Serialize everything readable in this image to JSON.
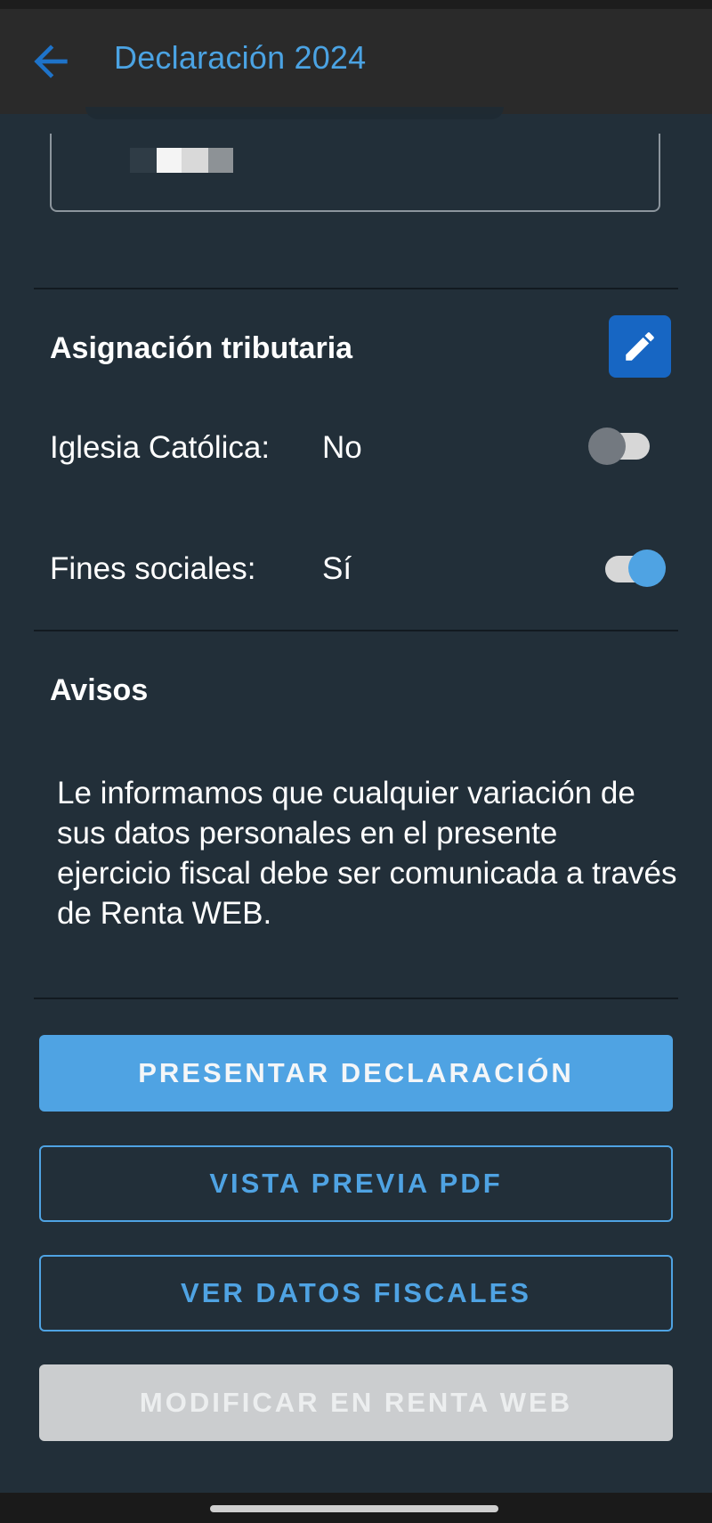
{
  "app_bar": {
    "title": "Declaración 2024",
    "back_icon": "arrow-left-icon"
  },
  "assignment": {
    "title": "Asignación tributaria",
    "edit_icon": "pencil-icon",
    "rows": [
      {
        "label": "Iglesia Católica:",
        "value": "No",
        "enabled": false
      },
      {
        "label": "Fines sociales:",
        "value": "Sí",
        "enabled": true
      }
    ]
  },
  "notices": {
    "title": "Avisos",
    "text": "Le informamos que cualquier variación de sus datos personales en el presente ejercicio fiscal debe ser comunicada a través de Renta WEB."
  },
  "actions": {
    "present": "PRESENTAR DECLARACIÓN",
    "preview_pdf": "VISTA PREVIA PDF",
    "fiscal_data": "VER DATOS FISCALES",
    "modify_web": "MODIFICAR EN RENTA WEB"
  },
  "colors": {
    "accent": "#4fa3e3",
    "edit_button": "#1766c3",
    "background": "#222f39",
    "disabled": "#cbcdcf"
  }
}
